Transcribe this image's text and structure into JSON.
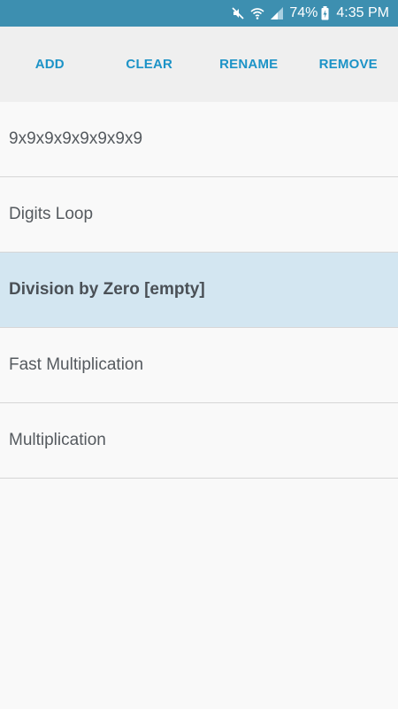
{
  "status_bar": {
    "battery_percent": "74%",
    "time": "4:35 PM",
    "icons": [
      "mute-icon",
      "wifi-icon",
      "signal-icon",
      "battery-charging-icon"
    ]
  },
  "toolbar": {
    "add_label": "ADD",
    "clear_label": "CLEAR",
    "rename_label": "RENAME",
    "remove_label": "REMOVE"
  },
  "list": {
    "items": [
      {
        "label": "9x9x9x9x9x9x9x9",
        "selected": false
      },
      {
        "label": "Digits Loop",
        "selected": false
      },
      {
        "label": "Division by Zero [empty]",
        "selected": true
      },
      {
        "label": "Fast Multiplication",
        "selected": false
      },
      {
        "label": "Multiplication",
        "selected": false
      }
    ]
  },
  "colors": {
    "status_bar_bg": "#3d8fb0",
    "toolbar_bg": "#efefef",
    "accent": "#1c93c7",
    "selected_bg": "#d3e6f1",
    "text": "#555a5f"
  }
}
